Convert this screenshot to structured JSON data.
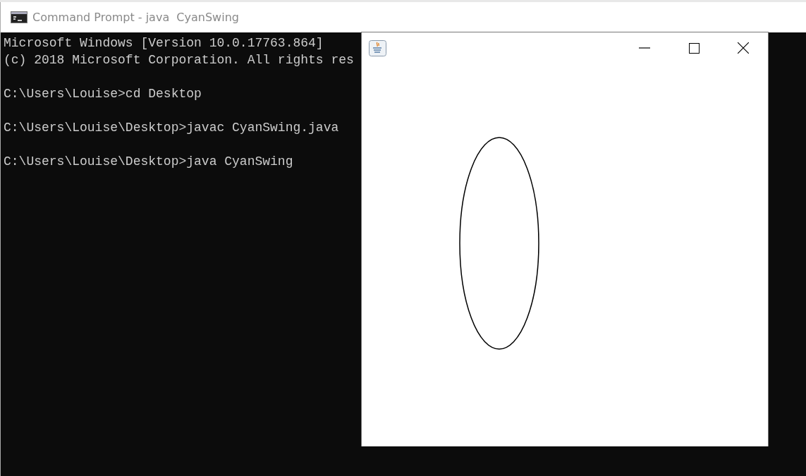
{
  "console_window": {
    "title": "Command Prompt - java  CyanSwing",
    "lines": [
      {
        "kind": "output",
        "text": "Microsoft Windows [Version 10.0.17763.864]"
      },
      {
        "kind": "output",
        "text": "(c) 2018 Microsoft Corporation. All rights res"
      },
      {
        "kind": "prompt",
        "text": "C:\\Users\\Louise>cd Desktop"
      },
      {
        "kind": "prompt",
        "text": "C:\\Users\\Louise\\Desktop>javac CyanSwing.java"
      },
      {
        "kind": "prompt",
        "text": "C:\\Users\\Louise\\Desktop>java CyanSwing"
      }
    ]
  }
}
